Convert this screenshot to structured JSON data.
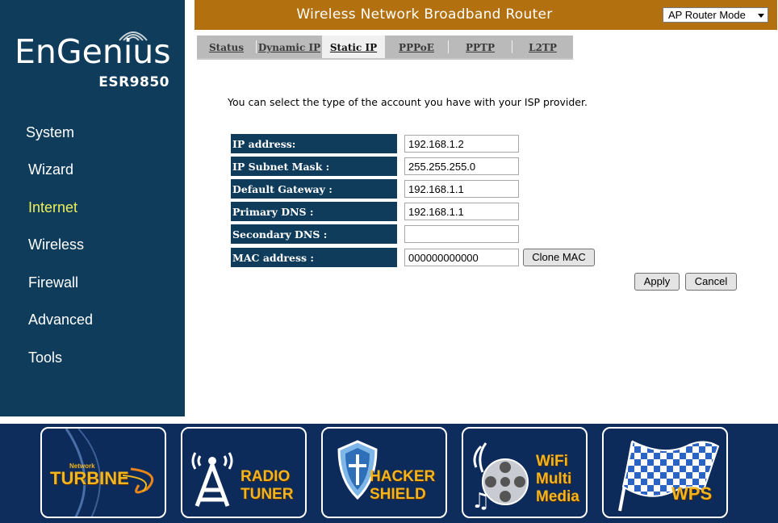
{
  "brand": {
    "name": "EnGenius",
    "model": "ESR9850"
  },
  "sidebar": {
    "items": [
      {
        "label": "System",
        "active": false
      },
      {
        "label": "Wizard",
        "active": false
      },
      {
        "label": "Internet",
        "active": true
      },
      {
        "label": "Wireless",
        "active": false
      },
      {
        "label": "Firewall",
        "active": false
      },
      {
        "label": "Advanced",
        "active": false
      },
      {
        "label": "Tools",
        "active": false
      }
    ]
  },
  "header": {
    "title": "Wireless Network Broadband Router",
    "mode_select": "AP Router Mode"
  },
  "tabs": [
    {
      "label": "Status",
      "active": false
    },
    {
      "label": "Dynamic IP",
      "active": false
    },
    {
      "label": "Static IP",
      "active": true
    },
    {
      "label": "PPPoE",
      "active": false
    },
    {
      "label": "PPTP",
      "active": false
    },
    {
      "label": "L2TP",
      "active": false
    }
  ],
  "main": {
    "intro": "You can select the type of the account you have with your ISP provider.",
    "fields": [
      {
        "label": "IP address:",
        "value": "192.168.1.2"
      },
      {
        "label": "IP Subnet Mask :",
        "value": "255.255.255.0"
      },
      {
        "label": "Default Gateway :",
        "value": "192.168.1.1"
      },
      {
        "label": "Primary DNS :",
        "value": "192.168.1.1"
      },
      {
        "label": "Secondary DNS :",
        "value": ""
      },
      {
        "label": "MAC address :",
        "value": "000000000000"
      }
    ],
    "clone_mac_label": "Clone MAC",
    "apply_label": "Apply",
    "cancel_label": "Cancel"
  },
  "banner": {
    "turbine": {
      "small": "Network",
      "label": "TURBINE"
    },
    "radio": {
      "line1": "RADIO",
      "line2": "TUNER"
    },
    "hacker": {
      "line1": "HACKER",
      "line2": "SHIELD"
    },
    "media": {
      "line1": "WiFi",
      "line2": "Multi",
      "line3": "Media"
    },
    "wps": {
      "label": "WPS"
    }
  },
  "colors": {
    "sidebar": "#0f3c5a",
    "header": "#b2700e",
    "active_nav": "#ecf05b",
    "banner": "#0e2d5c",
    "banner_text": "#f2b51e"
  }
}
